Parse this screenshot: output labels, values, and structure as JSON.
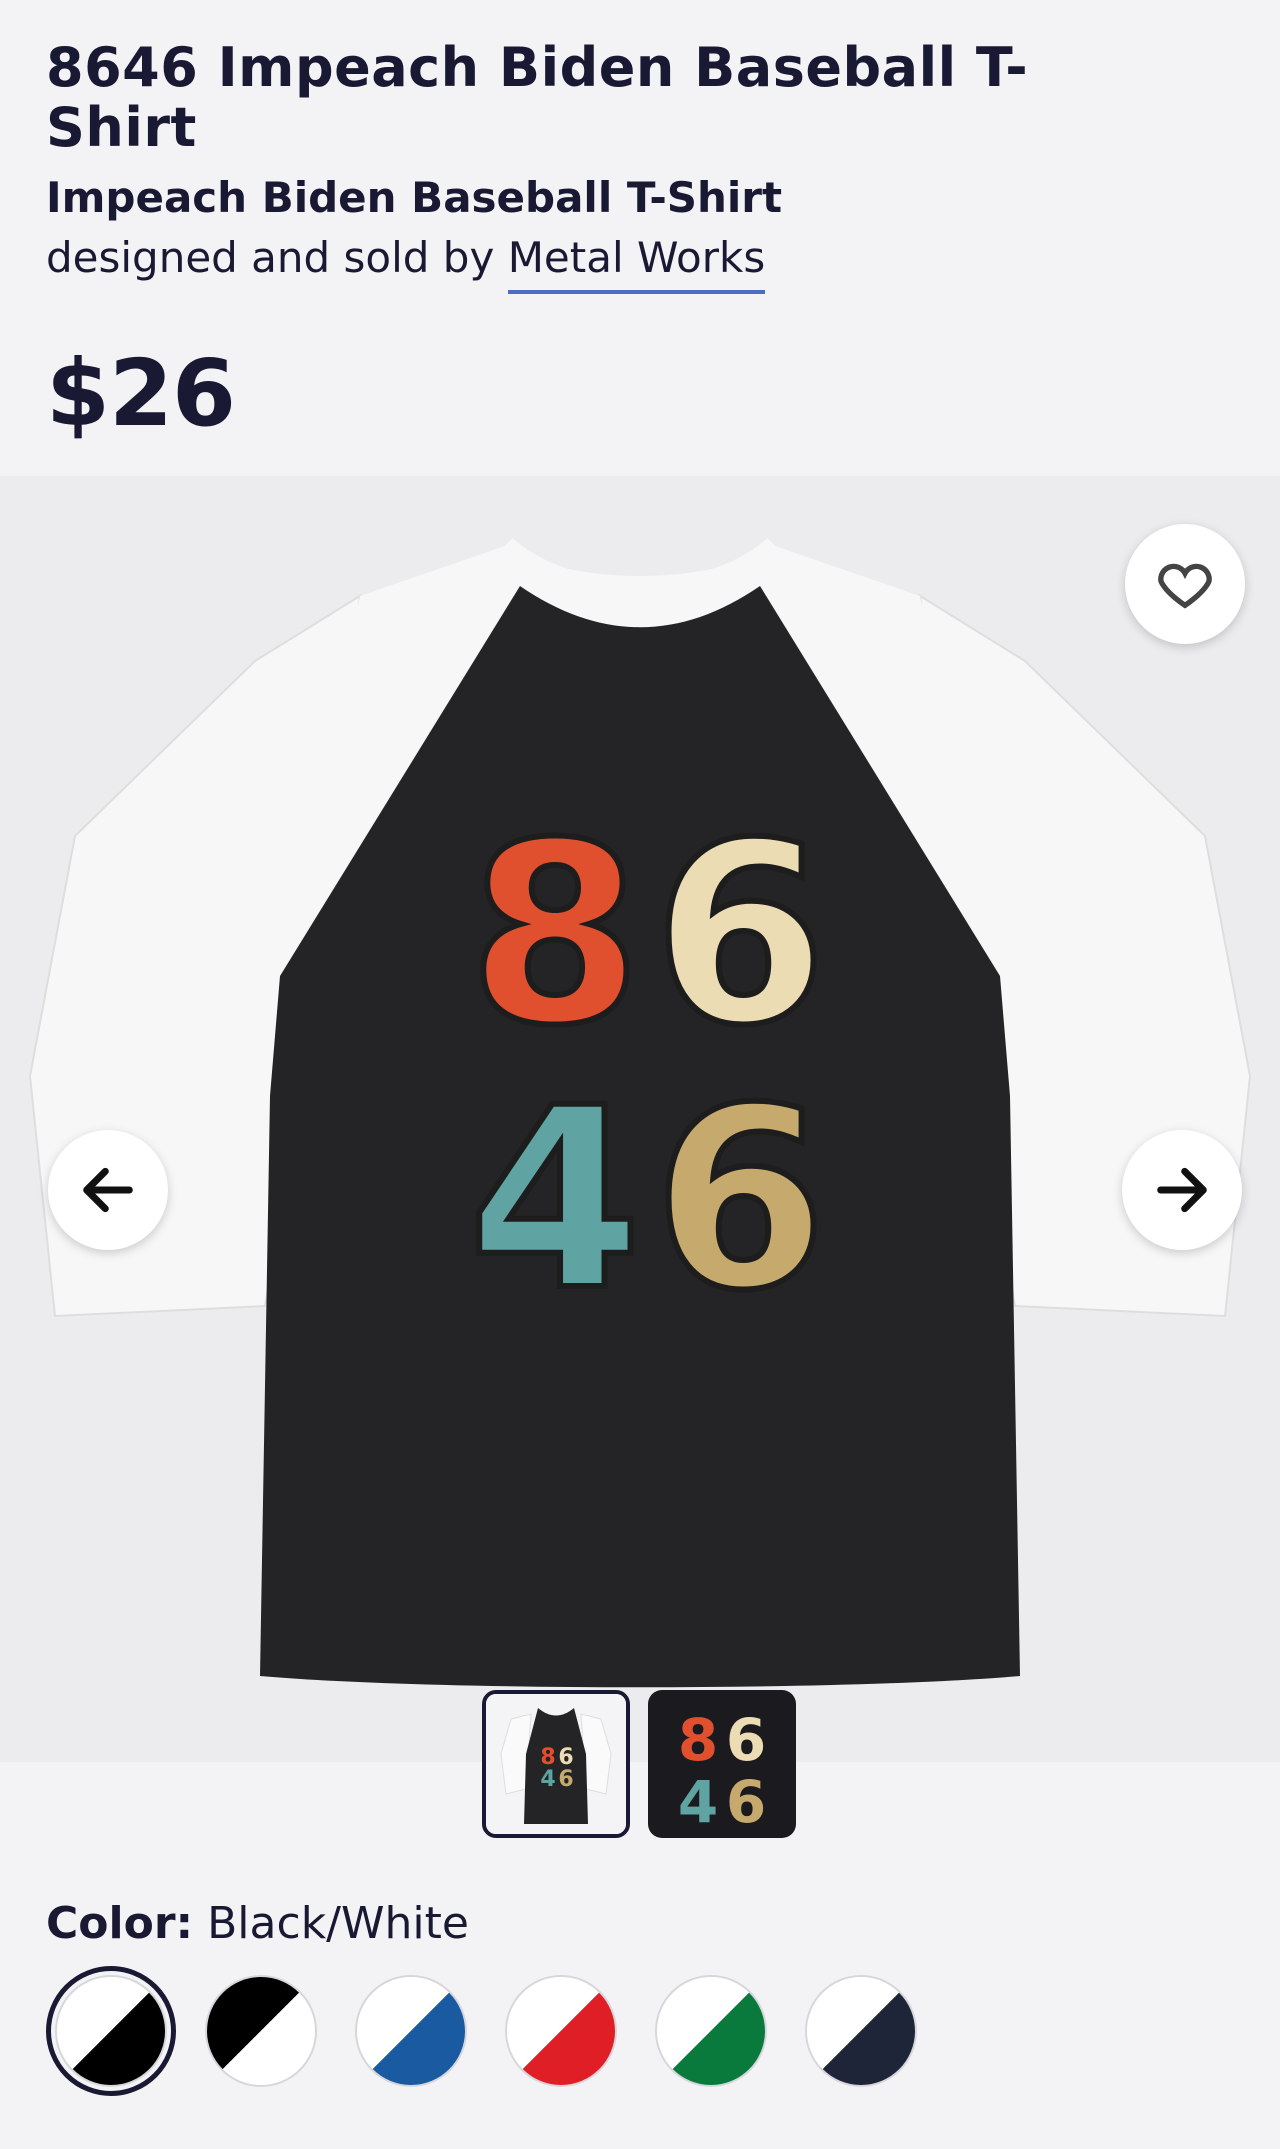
{
  "product": {
    "title": "8646 Impeach Biden Baseball T-Shirt",
    "subtitle": "Impeach Biden Baseball T-Shirt",
    "byline_prefix": "designed and sold by",
    "designer": "Metal Works",
    "price": "$26"
  },
  "print": {
    "digits": [
      {
        "char": "8",
        "color": "#e0502e"
      },
      {
        "char": "6",
        "color": "#ecdcb4"
      },
      {
        "char": "4",
        "color": "#5fa3a3"
      },
      {
        "char": "6",
        "color": "#c6aa6d"
      }
    ]
  },
  "gallery": {
    "favorite_icon": "heart-outline-icon",
    "prev_icon": "arrow-left-icon",
    "next_icon": "arrow-right-icon",
    "thumbnails": [
      {
        "label": "Baseball T-Shirt front view",
        "selected": true
      },
      {
        "label": "Design close-up",
        "selected": false
      }
    ]
  },
  "color_selector": {
    "label": "Color:",
    "selected_value": "Black/White",
    "swatches": [
      {
        "name": "Black/White",
        "primary": "#000000",
        "secondary": "#ffffff",
        "selected": true
      },
      {
        "name": "White/Black",
        "primary": "#ffffff",
        "secondary": "#000000",
        "selected": false
      },
      {
        "name": "Royal/White",
        "primary": "#1a5aa0",
        "secondary": "#ffffff",
        "selected": false
      },
      {
        "name": "Red/White",
        "primary": "#e01e26",
        "secondary": "#ffffff",
        "selected": false
      },
      {
        "name": "Green/White",
        "primary": "#0a7a3c",
        "secondary": "#ffffff",
        "selected": false
      },
      {
        "name": "Navy/White",
        "primary": "#1f2538",
        "secondary": "#ffffff",
        "selected": false
      }
    ]
  }
}
